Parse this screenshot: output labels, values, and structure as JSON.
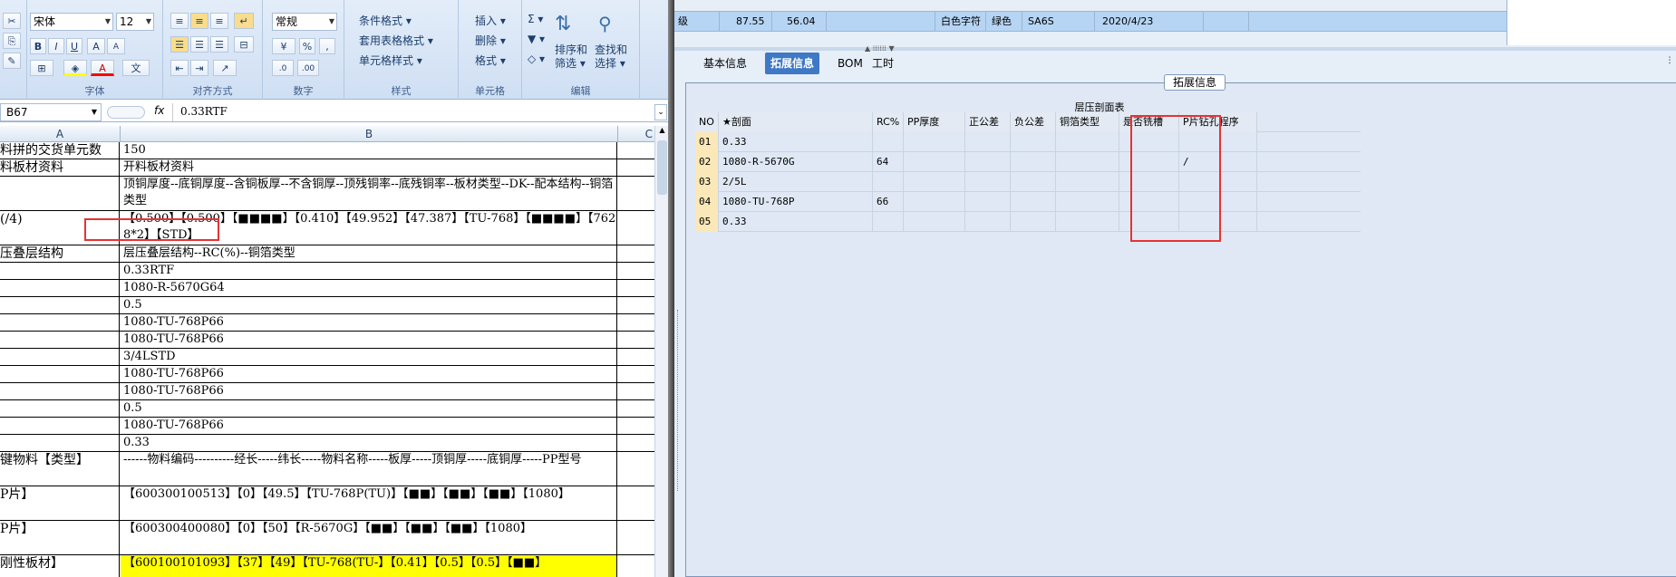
{
  "excel": {
    "ribbon": {
      "font_name": "宋体",
      "font_size": "12",
      "font_group": "字体",
      "align_group": "对齐方式",
      "number_format": "常规",
      "number_group": "数字",
      "styles": {
        "cond": "条件格式 ▾",
        "table": "套用表格格式 ▾",
        "cell": "单元格样式 ▾",
        "group": "样式"
      },
      "cells": {
        "insert": "插入 ▾",
        "delete": "删除 ▾",
        "format": "格式 ▾",
        "group": "单元格"
      },
      "edit": {
        "sort": "排序和\n筛选 ▾",
        "find": "查找和\n选择 ▾",
        "group": "编辑"
      },
      "bold": "B",
      "italic": "I",
      "underline": "U",
      "pct": "%",
      "comma": ","
    },
    "namebox": "B67",
    "fx": "fx",
    "formula": "0.33RTF",
    "columns": [
      "A",
      "B",
      "C"
    ],
    "rows": [
      {
        "a": "料拼的交货单元数",
        "b": "150"
      },
      {
        "a": "料板材资料",
        "b": "开料板材资料"
      },
      {
        "a": "",
        "b": "顶铜厚度--底铜厚度--含铜板厚--不含铜厚--顶残铜率--底残铜率--板材类型--DK--配本结构--铜箔类型"
      },
      {
        "a": "(/4)",
        "b": "【0.500】【0.500】【■■■■】【0.410】【49.952】【47.387】【TU-768】【■■■■】【7628*2】【STD】"
      },
      {
        "a": "压叠层结构",
        "b": "层压叠层结构--RC(%)--铜箔类型"
      },
      {
        "a": "",
        "b": "0.33RTF"
      },
      {
        "a": "",
        "b": "1080-R-5670G64"
      },
      {
        "a": "",
        "b": "0.5"
      },
      {
        "a": "",
        "b": "1080-TU-768P66"
      },
      {
        "a": "",
        "b": "1080-TU-768P66"
      },
      {
        "a": "",
        "b": "3/4LSTD"
      },
      {
        "a": "",
        "b": "1080-TU-768P66"
      },
      {
        "a": "",
        "b": "1080-TU-768P66"
      },
      {
        "a": "",
        "b": "0.5"
      },
      {
        "a": "",
        "b": "1080-TU-768P66"
      },
      {
        "a": "",
        "b": "0.33"
      },
      {
        "a": "键物料【类型】",
        "b": "------物料编码----------经长-----纬长-----物料名称-----板厚-----顶铜厚-----底铜厚-----PP型号"
      },
      {
        "a": "P片】",
        "b": "【600300100513】【0】【49.5】【TU-768P(TU)】【■■】【■■】【■■】【1080】"
      },
      {
        "a": "P片】",
        "b": "【600300400080】【0】【50】【R-5670G】【■■】【■■】【■■】【1080】"
      },
      {
        "a": "刚性板材】",
        "b": "【600100101093】【37】【49】【TU-768(TU-】【0.41】【0.5】【0.5】【■■】"
      }
    ]
  },
  "erp": {
    "top_row": [
      "级",
      "87.55",
      "56.04",
      "白色字符",
      "绿色",
      "SA6S",
      "2020/4/23"
    ],
    "tabs": [
      "基本信息",
      "拓展信息",
      "BOM",
      "工时"
    ],
    "active_tab": "拓展信息",
    "group_title": "拓展信息",
    "table_title": "层压剖面表",
    "columns": [
      "NO",
      "★剖面",
      "RC%",
      "PP厚度",
      "正公差",
      "负公差",
      "铜箔类型",
      "是否铣槽",
      "P片钻孔程序"
    ],
    "rows": [
      [
        "01",
        "0.33",
        "",
        "",
        "",
        "",
        "",
        "",
        ""
      ],
      [
        "02",
        "1080-R-5670G",
        "64",
        "",
        "",
        "",
        "",
        "",
        "/"
      ],
      [
        "03",
        "2/5L",
        "",
        "",
        "",
        "",
        "",
        "",
        ""
      ],
      [
        "04",
        "1080-TU-768P",
        "66",
        "",
        "",
        "",
        "",
        "",
        ""
      ],
      [
        "05",
        "0.33",
        "",
        "",
        "",
        "",
        "",
        "",
        ""
      ]
    ]
  },
  "colors": {
    "highlight": "#e53333",
    "tab_active": "#3f78c4",
    "selected_row": "#b6d4f4",
    "yellow_row": "#ffff00"
  }
}
